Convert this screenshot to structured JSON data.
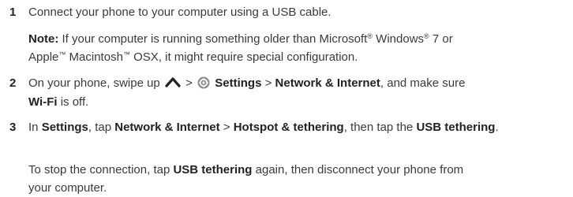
{
  "steps": [
    {
      "number": "1",
      "text": "Connect your phone to your computer using a USB cable."
    },
    {
      "number": "2",
      "t_before_icons": "On your phone, swipe up",
      "sep1": ">",
      "settings": "Settings",
      "sep2": ">",
      "network": "Network & Internet",
      "t_after": ", and make sure",
      "wifi": "Wi-Fi",
      "t_end": "is off."
    },
    {
      "number": "3",
      "t_in": "In",
      "settings": "Settings",
      "t_tap": ", tap",
      "network": "Network & Internet",
      "sep": ">",
      "hotspot": "Hotspot & tethering",
      "t_then": ", then tap the",
      "usb_tethering": "USB tethering",
      "t_end": "."
    }
  ],
  "note": {
    "label": "Note:",
    "t1": "If your computer is running something older than Microsoft",
    "reg": "®",
    "t2": "Windows",
    "reg2": "®",
    "t3": "7 or",
    "t4": "Apple",
    "tm1": "™",
    "t5": "Macintosh",
    "tm2": "™",
    "t6": "OSX, it might require special configuration."
  },
  "stop_para": {
    "t1": "To stop the connection, tap",
    "usb_tethering": "USB tethering",
    "t2": "again, then disconnect your phone from",
    "t3": "your computer."
  },
  "icons": {
    "swipe_up": "chevron-up-icon",
    "settings": "gear-icon"
  }
}
